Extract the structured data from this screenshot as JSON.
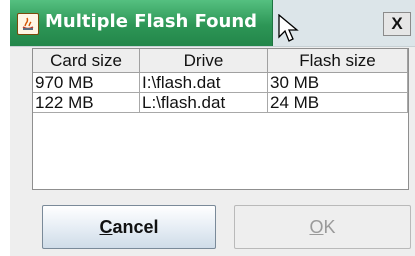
{
  "window": {
    "title": "Multiple Flash Found",
    "close_label": "X"
  },
  "table": {
    "columns": [
      "Card size",
      "Drive",
      "Flash size"
    ],
    "rows": [
      [
        "970 MB",
        "I:\\flash.dat",
        "30 MB"
      ],
      [
        "122 MB",
        "L:\\flash.dat",
        "24 MB"
      ]
    ]
  },
  "buttons": {
    "cancel": {
      "mnemonic": "C",
      "rest": "ancel"
    },
    "ok": {
      "mnemonic": "O",
      "rest": "K"
    }
  }
}
